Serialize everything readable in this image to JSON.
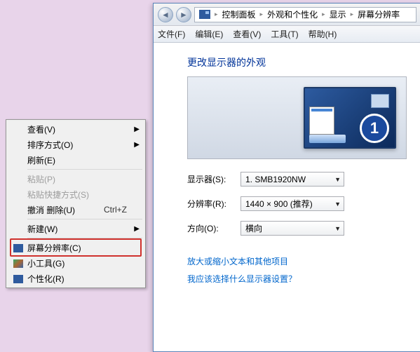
{
  "context_menu": {
    "items": [
      {
        "label": "查看(V)",
        "submenu": true
      },
      {
        "label": "排序方式(O)",
        "submenu": true
      },
      {
        "label": "刷新(E)"
      }
    ],
    "items2": [
      {
        "label": "粘贴(P)",
        "disabled": true
      },
      {
        "label": "粘贴快捷方式(S)",
        "disabled": true
      },
      {
        "label": "撤消 删除(U)",
        "shortcut": "Ctrl+Z"
      }
    ],
    "items3": [
      {
        "label": "新建(W)",
        "submenu": true
      }
    ],
    "items4": [
      {
        "label": "屏幕分辨率(C)",
        "icon": "display",
        "highlighted": true
      },
      {
        "label": "小工具(G)",
        "icon": "gadget"
      },
      {
        "label": "个性化(R)",
        "icon": "personalize"
      }
    ]
  },
  "window": {
    "breadcrumb": {
      "root_icon": "display-icon",
      "items": [
        "控制面板",
        "外观和个性化",
        "显示",
        "屏幕分辨率"
      ]
    },
    "menu": [
      "文件(F)",
      "编辑(E)",
      "查看(V)",
      "工具(T)",
      "帮助(H)"
    ],
    "page_title": "更改显示器的外观",
    "monitor_number": "1",
    "form": {
      "display_label": "显示器(S):",
      "display_value": "1. SMB1920NW",
      "resolution_label": "分辨率(R):",
      "resolution_value": "1440 × 900 (推荐)",
      "orientation_label": "方向(O):",
      "orientation_value": "横向"
    },
    "links": {
      "text_size": "放大或缩小文本和其他项目",
      "which_display": "我应该选择什么显示器设置？"
    }
  }
}
